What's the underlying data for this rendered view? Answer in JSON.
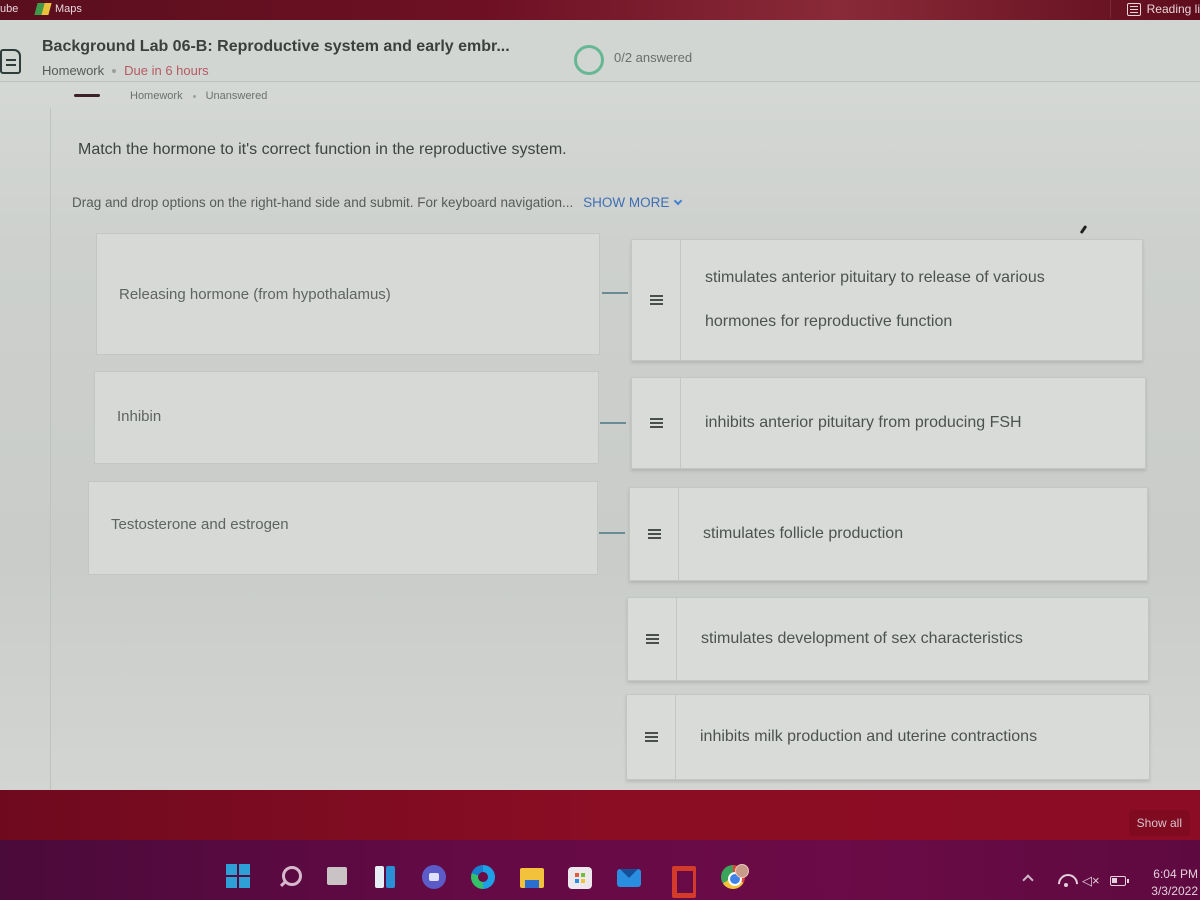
{
  "browser": {
    "favorites": [
      {
        "label": "ube",
        "icon": "youtube-icon"
      },
      {
        "label": "Maps",
        "icon": "maps-icon"
      }
    ],
    "reading_list": {
      "label": "Reading li",
      "icon": "reading-list-icon"
    }
  },
  "assignment": {
    "title": "Background Lab 06-B: Reproductive system and early embr...",
    "type": "Homework",
    "due": "Due in 6 hours",
    "progress_text": "0/2 answered",
    "progress_fraction": 0
  },
  "question_meta": {
    "type": "Homework",
    "status": "Unanswered"
  },
  "question": {
    "prompt": "Match the hormone to it's correct function in the reproductive system.",
    "instructions": "Drag and drop options on the right-hand side and submit. For keyboard navigation...",
    "show_more_label": "SHOW MORE",
    "premises": [
      "Releasing hormone (from hypothalamus)",
      "Inhibin",
      "Testosterone and estrogen"
    ],
    "responses": [
      {
        "line1": "stimulates anterior pituitary to release of various",
        "line2": "hormones for reproductive function"
      },
      {
        "line1": "inhibits anterior pituitary from producing FSH",
        "line2": ""
      },
      {
        "line1": "stimulates follicle production",
        "line2": ""
      },
      {
        "line1": "stimulates development of sex characteristics",
        "line2": ""
      },
      {
        "line1": "inhibits milk production and uterine contractions",
        "line2": ""
      }
    ]
  },
  "downloads": {
    "show_all_label": "Show all"
  },
  "taskbar": {
    "apps": [
      "start",
      "search",
      "task-view",
      "widgets",
      "teams-chat",
      "edge",
      "file-explorer",
      "microsoft-store",
      "mail",
      "office",
      "chrome"
    ],
    "time": "6:04 PM",
    "date": "3/3/2022",
    "tray": [
      "show-hidden-icons",
      "wifi",
      "volume-muted",
      "battery"
    ],
    "volume_glyph": "◁×"
  }
}
